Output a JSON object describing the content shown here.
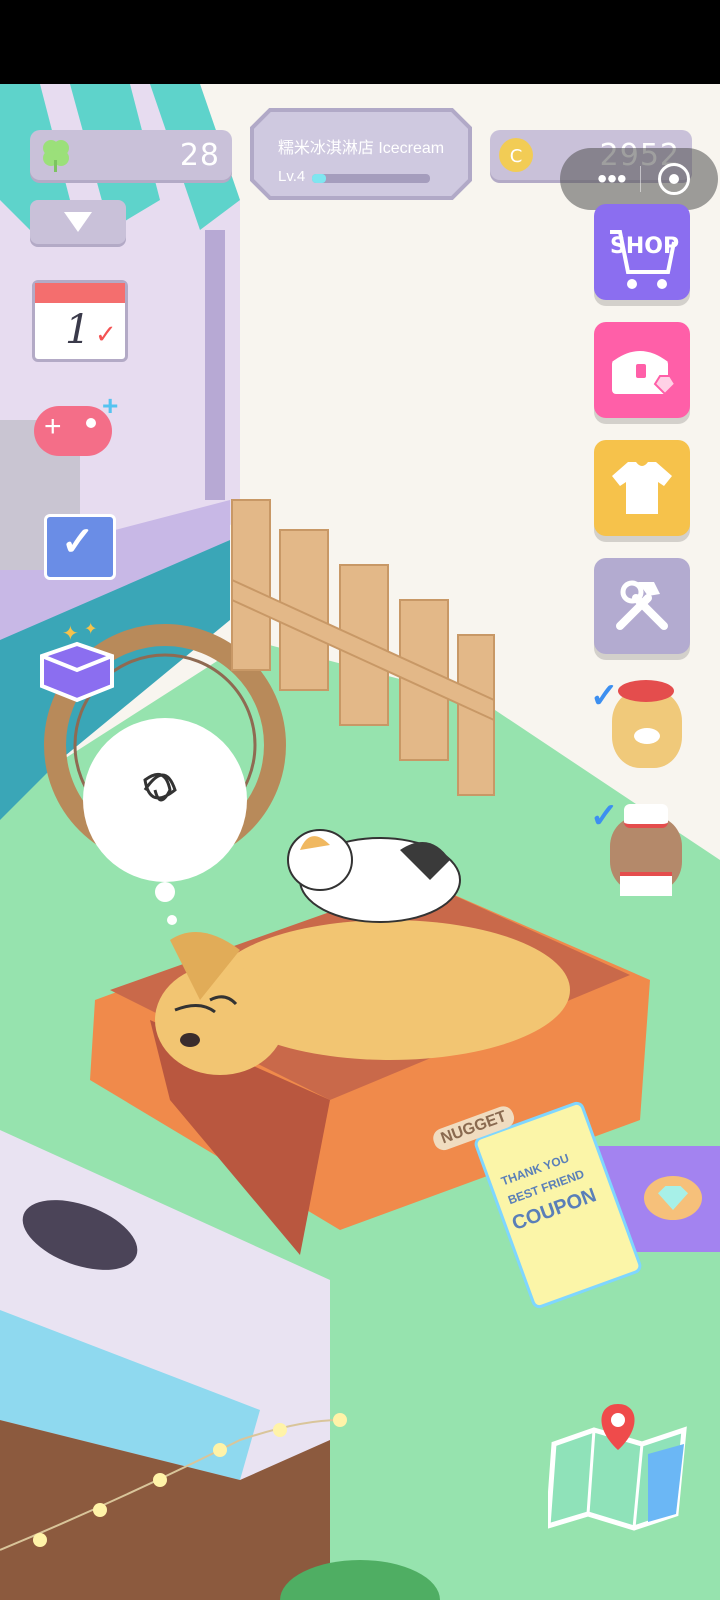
{
  "hud": {
    "clover_count": "28",
    "shop_name": "糯米冰淇淋店 Icecream",
    "level": "Lv.4",
    "level_progress": 0.12,
    "coins": "2952"
  },
  "menu": {
    "shop_label": "SHOP",
    "calendar_day": "1"
  },
  "coupon": {
    "tag": "NUGGET",
    "line1": "THANK YOU",
    "line2": "BEST FRIEND",
    "line3": "COUPON"
  },
  "colors": {
    "grass": "#96e3ae",
    "shop_button": "#8b6ef0",
    "chest_button": "#ff5fa8",
    "shirt_button": "#f6c24b",
    "tools_button": "#b3abd0",
    "accent_teal": "#5ed3cb"
  },
  "icons": [
    "clover-icon",
    "dropdown-arrow-icon",
    "calendar-icon",
    "gamepad-icon",
    "checklist-icon",
    "gift-box-icon",
    "coin-icon",
    "more-dots-icon",
    "target-icon",
    "cart-icon",
    "chest-icon",
    "shirt-icon",
    "tools-icon",
    "map-icon",
    "diamond-icon"
  ]
}
